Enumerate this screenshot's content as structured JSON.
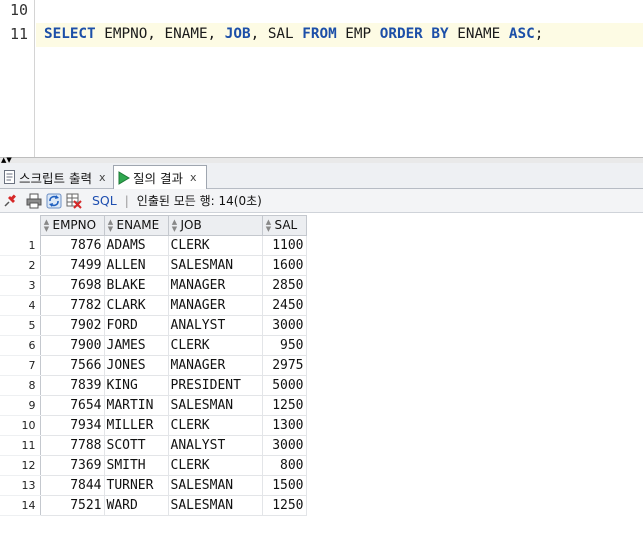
{
  "editor": {
    "lines": [
      {
        "number": "10",
        "text": ""
      },
      {
        "number": "11",
        "tokens": [
          {
            "t": "SELECT",
            "kw": true
          },
          {
            "t": " EMPNO, ENAME, ",
            "kw": false
          },
          {
            "t": "JOB",
            "kw": true
          },
          {
            "t": ", SAL ",
            "kw": false
          },
          {
            "t": "FROM",
            "kw": true
          },
          {
            "t": " EMP ",
            "kw": false
          },
          {
            "t": "ORDER BY",
            "kw": true
          },
          {
            "t": " ENAME ",
            "kw": false
          },
          {
            "t": "ASC",
            "kw": true
          },
          {
            "t": ";",
            "kw": false
          }
        ]
      }
    ]
  },
  "tabs": [
    {
      "label": "스크립트 출력",
      "close": "x",
      "icon": "script-output-icon"
    },
    {
      "label": "질의 결과",
      "close": "x",
      "icon": "play-icon",
      "active": true
    }
  ],
  "toolbar": {
    "sql_label": "SQL",
    "separator": "|",
    "status": "인출된 모든 행: 14(0초)"
  },
  "grid": {
    "columns": [
      "EMPNO",
      "ENAME",
      "JOB",
      "SAL"
    ],
    "rows": [
      [
        "1",
        "7876",
        "ADAMS",
        "CLERK",
        "1100"
      ],
      [
        "2",
        "7499",
        "ALLEN",
        "SALESMAN",
        "1600"
      ],
      [
        "3",
        "7698",
        "BLAKE",
        "MANAGER",
        "2850"
      ],
      [
        "4",
        "7782",
        "CLARK",
        "MANAGER",
        "2450"
      ],
      [
        "5",
        "7902",
        "FORD",
        "ANALYST",
        "3000"
      ],
      [
        "6",
        "7900",
        "JAMES",
        "CLERK",
        "950"
      ],
      [
        "7",
        "7566",
        "JONES",
        "MANAGER",
        "2975"
      ],
      [
        "8",
        "7839",
        "KING",
        "PRESIDENT",
        "5000"
      ],
      [
        "9",
        "7654",
        "MARTIN",
        "SALESMAN",
        "1250"
      ],
      [
        "10",
        "7934",
        "MILLER",
        "CLERK",
        "1300"
      ],
      [
        "11",
        "7788",
        "SCOTT",
        "ANALYST",
        "3000"
      ],
      [
        "12",
        "7369",
        "SMITH",
        "CLERK",
        "800"
      ],
      [
        "13",
        "7844",
        "TURNER",
        "SALESMAN",
        "1500"
      ],
      [
        "14",
        "7521",
        "WARD",
        "SALESMAN",
        "1250"
      ]
    ]
  },
  "colors": {
    "keyword": "#1c4fa8",
    "current_line": "#fdfbe4",
    "play_green": "#2fa84f"
  }
}
